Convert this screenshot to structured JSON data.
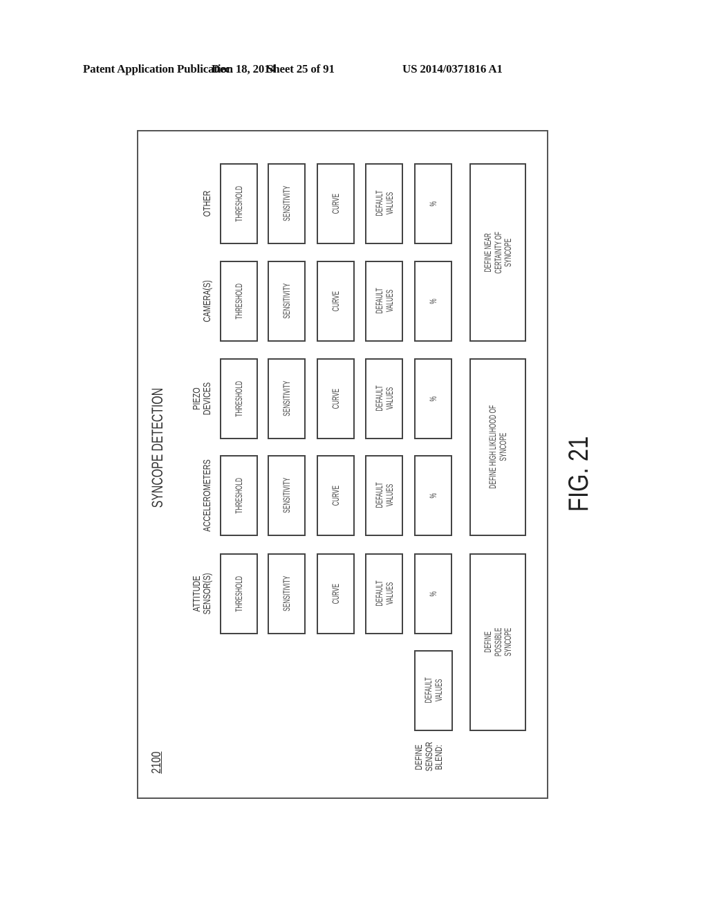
{
  "page_header": {
    "publication": "Patent Application Publication",
    "date": "Dec. 18, 2014",
    "sheet": "Sheet 25 of 91",
    "number": "US 2014/0371816 A1"
  },
  "figure": {
    "label": "FIG. 21",
    "reference": "2100",
    "title": "SYNCOPE DETECTION",
    "orientation": "rotated 90 degrees counter-clockwise",
    "sensor_blend_label": "DEFINE\nSENSOR\nBLEND:",
    "sensor_blend_default": "DEFAULT\nVALUES",
    "sensors": [
      {
        "name": "ATTITUDE\nSENSOR(S)",
        "threshold": "THRESHOLD",
        "sensitivity": "SENSITIVITY",
        "curve": "CURVE",
        "defaults": "DEFAULT\nVALUES",
        "percent": "%"
      },
      {
        "name": "ACCELEROMETERS",
        "threshold": "THRESHOLD",
        "sensitivity": "SENSITIVITY",
        "curve": "CURVE",
        "defaults": "DEFAULT\nVALUES",
        "percent": "%"
      },
      {
        "name": "PIEZO\nDEVICES",
        "threshold": "THRESHOLD",
        "sensitivity": "SENSITIVITY",
        "curve": "CURVE",
        "defaults": "DEFAULT\nVALUES",
        "percent": "%"
      },
      {
        "name": "CAMERA(S)",
        "threshold": "THRESHOLD",
        "sensitivity": "SENSITIVITY",
        "curve": "CURVE",
        "defaults": "DEFAULT\nVALUES",
        "percent": "%"
      },
      {
        "name": "OTHER",
        "threshold": "THRESHOLD",
        "sensitivity": "SENSITIVITY",
        "curve": "CURVE",
        "defaults": "DEFAULT\nVALUES",
        "percent": "%"
      }
    ],
    "definitions": [
      {
        "label": "DEFINE\nPOSSIBLE\nSYNCOPE"
      },
      {
        "label": "DEFINE HIGH LIKELIHOOD OF\nSYNCOPE"
      },
      {
        "label": "DEFINE NEAR\nCERTAINTY OF\nSYNCOPE"
      }
    ]
  }
}
